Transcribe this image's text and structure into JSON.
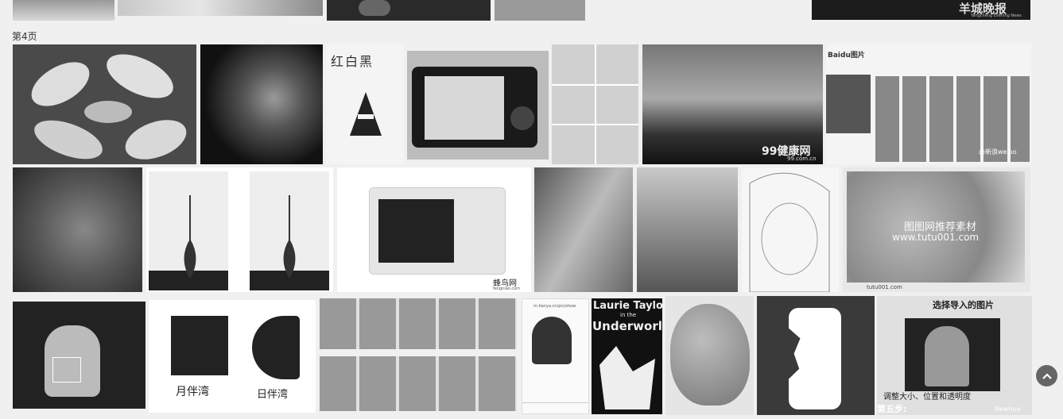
{
  "page_label": "第4页",
  "top_row": {
    "newspaper_logo": "羊城晚报",
    "newspaper_sub": "Yangcheng Evening News"
  },
  "row1": {
    "book_title": "红白黑",
    "baidu_logo": "Baidu图片",
    "health_site": "99健康网",
    "health_url": "99.com.cn",
    "weibo_watermark": "@新浪weibo"
  },
  "row2": {
    "fengniao_name": "蜂鸟网",
    "fengniao_url": "fengniao.com",
    "tutu_watermark_cn": "图图网推荐素材",
    "tutu_watermark_url": "www.tutu001.com",
    "tutu_footer": "tutu001.com"
  },
  "row3": {
    "brand_name": "月伴湾",
    "brand_name_alt": "日伴湾",
    "browser_url": "m.tianya.cn/pic/show",
    "book_title_line1": "Laurie Taylor",
    "book_title_line2": "in the",
    "book_title_line3": "Underworld",
    "tutorial_step_title": "选择导入的图片",
    "tutorial_step_caption": "调整大小、位置和透明度",
    "tutorial_step_label": "第五步:",
    "tutorial_watermark": "Newhua"
  },
  "scroll_top_icon": "chevron-up-icon"
}
